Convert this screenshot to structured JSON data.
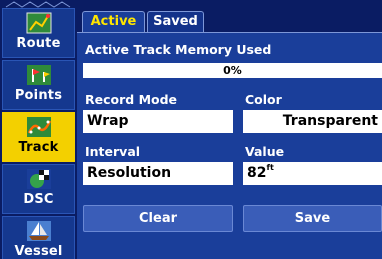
{
  "sidebar": {
    "items": [
      {
        "label": "Route",
        "icon": "route-icon"
      },
      {
        "label": "Points",
        "icon": "points-icon"
      },
      {
        "label": "Track",
        "icon": "track-icon",
        "active": true
      },
      {
        "label": "DSC",
        "icon": "dsc-icon"
      },
      {
        "label": "Vessel",
        "icon": "vessel-icon"
      }
    ]
  },
  "tabs": {
    "active_label": "Active",
    "saved_label": "Saved"
  },
  "memory": {
    "title": "Active Track Memory Used",
    "percent_text": "0%",
    "percent_value": 0
  },
  "fields": {
    "record_mode_label": "Record Mode",
    "record_mode_value": "Wrap",
    "color_label": "Color",
    "color_value": "Transparent",
    "interval_label": "Interval",
    "interval_value": "Resolution",
    "value_label": "Value",
    "value_value": "82",
    "value_unit": "ft"
  },
  "buttons": {
    "clear_label": "Clear",
    "save_label": "Save"
  },
  "colors": {
    "background": "#0b2274",
    "panel": "#1a3e9a",
    "active_tab_text": "#ffe600",
    "active_sidebar": "#f3d000"
  }
}
